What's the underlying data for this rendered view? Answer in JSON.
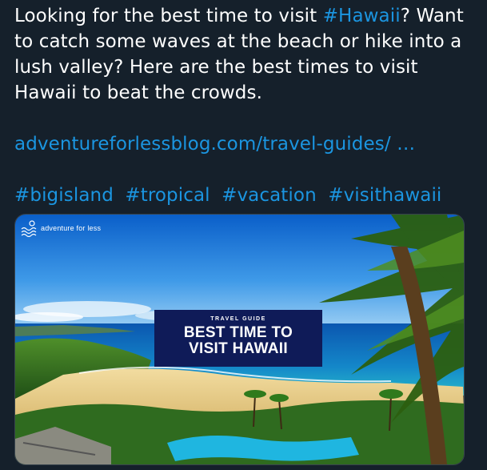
{
  "tweet": {
    "text_line1_prefix": "Looking for the best time to visit ",
    "hashtag_hawaii": "#Hawaii",
    "text_line1_suffix": "?",
    "text_rest": "Want to catch some waves at the beach or hike into a lush valley? Here are the best times to visit Hawaii to beat the crowds.",
    "link_url": "adventureforlessblog.com/travel-guides/ …",
    "hashtags": [
      "#bigisland",
      "#tropical",
      "#vacation",
      "#visithawaii"
    ]
  },
  "media": {
    "brand_name": "adventure for less",
    "kicker": "TRAVEL GUIDE",
    "title_line1": "BEST TIME TO",
    "title_line2": "VISIT HAWAII"
  },
  "colors": {
    "background": "#15202b",
    "text": "#ffffff",
    "link": "#1b95e0",
    "guide_box": "#0f1b58"
  },
  "icons": [
    "waves-logo-icon"
  ]
}
